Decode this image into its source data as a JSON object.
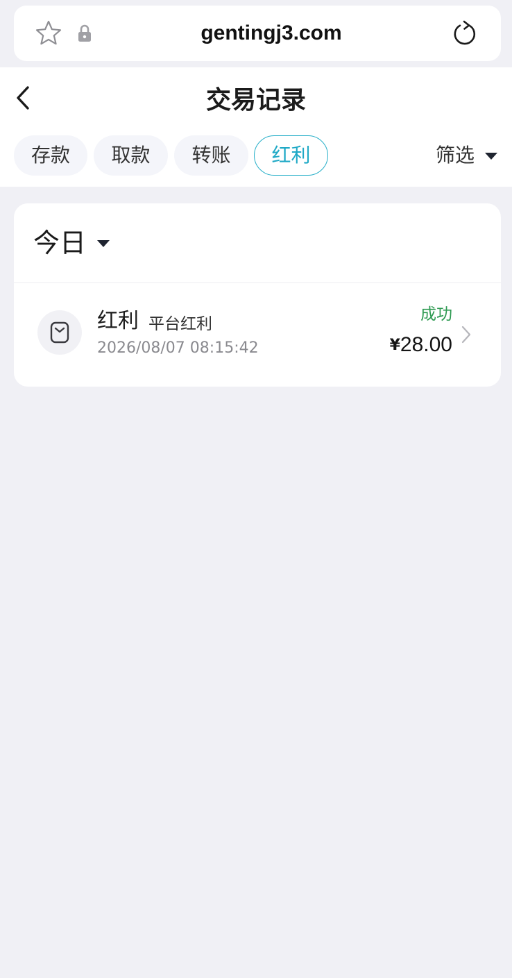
{
  "browser": {
    "url": "gentingj3.com",
    "icons": {
      "favorite": "star-icon",
      "secure": "lock-icon",
      "reload": "reload-icon"
    }
  },
  "header": {
    "back_icon": "chevron-left-icon",
    "title": "交易记录"
  },
  "tabs": [
    {
      "label": "存款",
      "active": false
    },
    {
      "label": "取款",
      "active": false
    },
    {
      "label": "转账",
      "active": false
    },
    {
      "label": "红利",
      "active": true
    }
  ],
  "filter": {
    "label": "筛选",
    "icon": "caret-down-icon"
  },
  "date_group": {
    "label": "今日",
    "icon": "caret-down-icon"
  },
  "records": [
    {
      "icon": "wallet-icon",
      "type": "红利",
      "subtype": "平台红利",
      "time": "2026/08/07 08:15:42",
      "status": "成功",
      "currency": "¥",
      "amount": "28.00"
    }
  ],
  "colors": {
    "accent": "#24aec8",
    "success": "#2e9a52",
    "background": "#f0f0f5"
  }
}
